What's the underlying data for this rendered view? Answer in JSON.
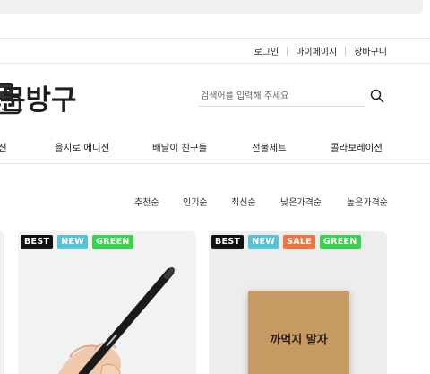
{
  "header": {
    "util_links": [
      "로그인",
      "마이페이지",
      "장바구니"
    ],
    "logo_text": "문방구",
    "search_placeholder": "검색어를 입력해 주세요"
  },
  "gnb": {
    "items": [
      "션",
      "을지로 에디션",
      "배달이 친구들",
      "선물세트",
      "콜라보레이션"
    ]
  },
  "sort": {
    "options": [
      "추천순",
      "인기순",
      "최신순",
      "낮은가격순",
      "높은가격순"
    ]
  },
  "products": [
    {
      "badges": [
        "BEST",
        "NEW",
        "GREEN"
      ],
      "image": "pencil-in-hand-photo"
    },
    {
      "badges": [
        "BEST",
        "NEW",
        "SALE",
        "GREEN"
      ],
      "image": "kraft-notebook-photo",
      "image_text": "까먹지 말자"
    }
  ],
  "colors": {
    "badge_best": "#111111",
    "badge_new": "#54c3d6",
    "badge_sale": "#f0743f",
    "badge_green": "#39d24f"
  }
}
